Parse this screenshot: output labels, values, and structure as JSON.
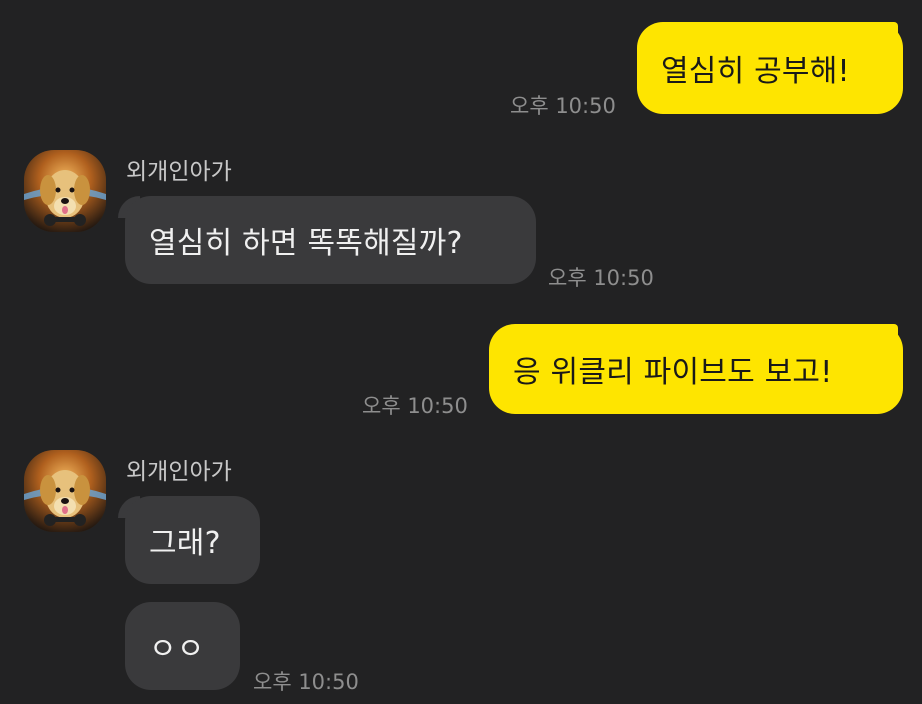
{
  "messages": [
    {
      "direction": "out",
      "text": "열심히 공부해!",
      "time": "오후 10:50"
    },
    {
      "direction": "in",
      "sender": "외개인아가",
      "text": "열심히 하면 똑똑해질까?",
      "time": "오후 10:50"
    },
    {
      "direction": "out",
      "text": "응 위클리 파이브도 보고!",
      "time": "오후 10:50"
    },
    {
      "direction": "in",
      "sender": "외개인아가",
      "text": "그래?",
      "time": ""
    },
    {
      "direction": "in",
      "text": "ㅇㅇ",
      "time": "오후 10:50"
    }
  ],
  "colors": {
    "background": "#222223",
    "outgoing_bubble": "#fee500",
    "incoming_bubble": "#3a3a3c",
    "timestamp": "#8e8e8e"
  },
  "icons": {
    "avatar": "golden-retriever-avatar-icon"
  }
}
